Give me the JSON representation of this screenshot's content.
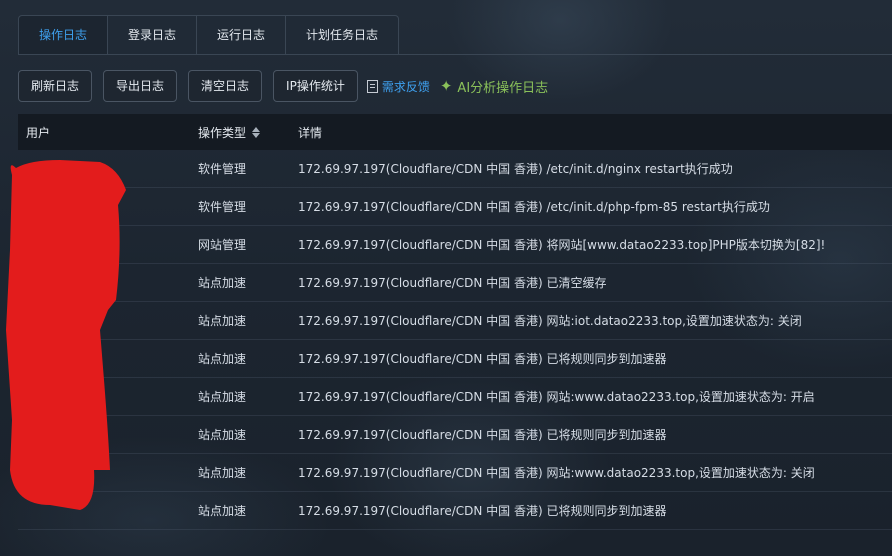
{
  "tabs": [
    "操作日志",
    "登录日志",
    "运行日志",
    "计划任务日志"
  ],
  "toolbar": {
    "buttons": [
      "刷新日志",
      "导出日志",
      "清空日志",
      "IP操作统计"
    ],
    "feedback_label": "需求反馈",
    "ai_label": "AI分析操作日志"
  },
  "table": {
    "headers": [
      "用户",
      "操作类型",
      "详情"
    ],
    "rows": [
      {
        "type": "软件管理",
        "detail": "172.69.97.197(Cloudflare/CDN 中国 香港) /etc/init.d/nginx restart执行成功"
      },
      {
        "type": "软件管理",
        "detail": "172.69.97.197(Cloudflare/CDN 中国 香港) /etc/init.d/php-fpm-85 restart执行成功"
      },
      {
        "type": "网站管理",
        "detail": "172.69.97.197(Cloudflare/CDN 中国 香港) 将网站[www.datao2233.top]PHP版本切换为[82]!"
      },
      {
        "type": "站点加速",
        "detail": "172.69.97.197(Cloudflare/CDN 中国 香港) 已清空缓存"
      },
      {
        "type": "站点加速",
        "detail": "172.69.97.197(Cloudflare/CDN 中国 香港) 网站:iot.datao2233.top,设置加速状态为: 关闭"
      },
      {
        "type": "站点加速",
        "detail": "172.69.97.197(Cloudflare/CDN 中国 香港) 已将规则同步到加速器"
      },
      {
        "type": "站点加速",
        "detail": "172.69.97.197(Cloudflare/CDN 中国 香港) 网站:www.datao2233.top,设置加速状态为: 开启"
      },
      {
        "type": "站点加速",
        "detail": "172.69.97.197(Cloudflare/CDN 中国 香港) 已将规则同步到加速器"
      },
      {
        "type": "站点加速",
        "detail": "172.69.97.197(Cloudflare/CDN 中国 香港) 网站:www.datao2233.top,设置加速状态为: 关闭"
      },
      {
        "type": "站点加速",
        "detail": "172.69.97.197(Cloudflare/CDN 中国 香港) 已将规则同步到加速器"
      }
    ]
  },
  "colors": {
    "accent": "#3ea0ee",
    "ai_green": "#8ac15a",
    "redaction": "#e31c1c"
  }
}
